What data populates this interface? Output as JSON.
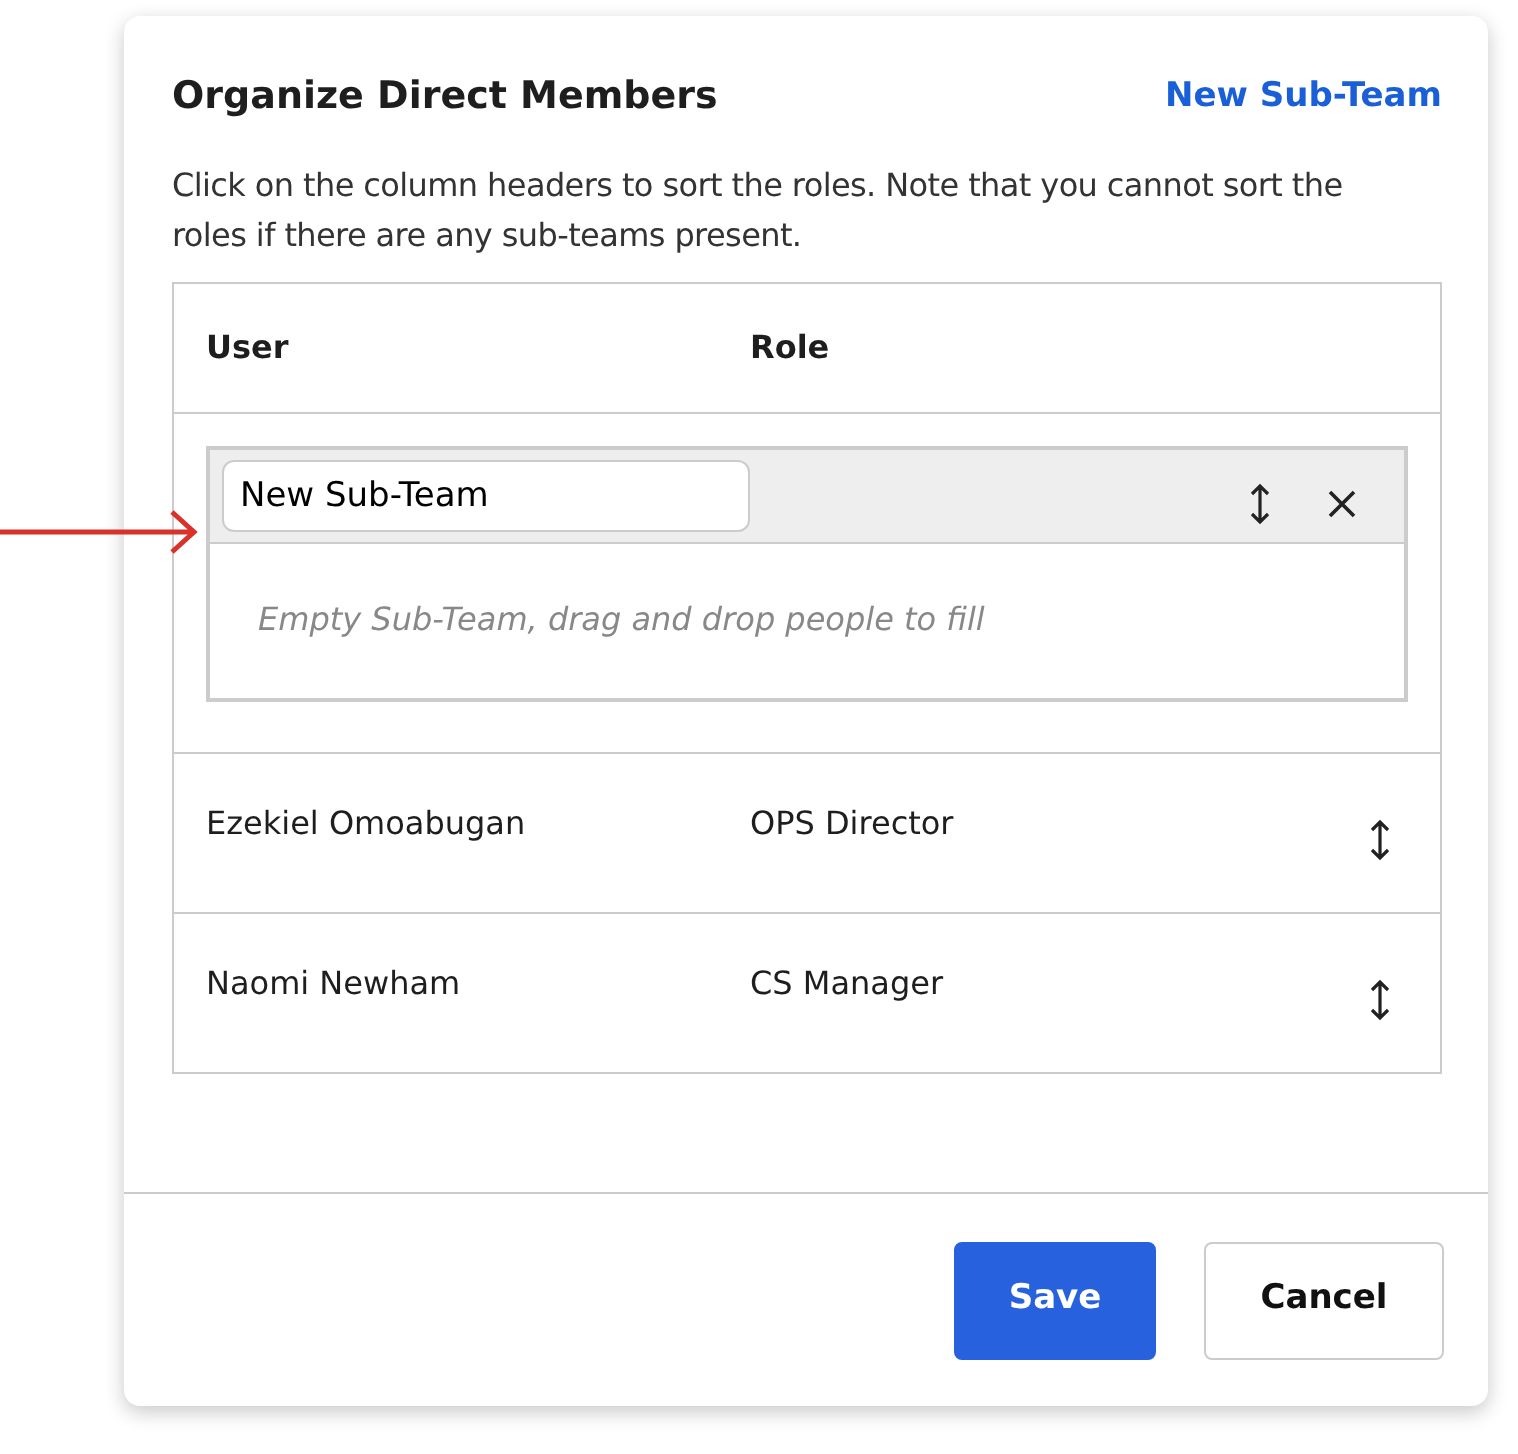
{
  "dialog": {
    "title": "Organize Direct Members",
    "action_link": "New Sub-Team",
    "description": "Click on the column headers to sort the roles. Note that you cannot sort the roles if there are any sub-teams present."
  },
  "table": {
    "columns": [
      "User",
      "Role"
    ],
    "sub_teams": [
      {
        "name": "New Sub-Team",
        "empty_text": "Empty Sub-Team, drag and drop people to fill"
      }
    ],
    "rows": [
      {
        "user": "Ezekiel Omoabugan",
        "role": "OPS Director"
      },
      {
        "user": "Naomi Newham",
        "role": "CS Manager"
      }
    ]
  },
  "buttons": [
    {
      "label": "Save",
      "kind": "primary"
    },
    {
      "label": "Cancel",
      "kind": "secondary"
    }
  ]
}
